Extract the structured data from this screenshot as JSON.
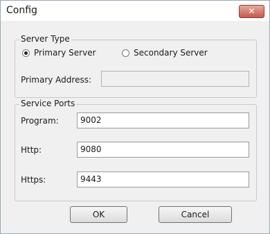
{
  "window": {
    "title": "Config",
    "close_glyph": "✕"
  },
  "server_type": {
    "label": "Server Type",
    "options": [
      {
        "label": "Primary Server",
        "checked": true
      },
      {
        "label": "Secondary Server",
        "checked": false
      }
    ],
    "primary_address": {
      "label": "Primary Address:",
      "value": ""
    }
  },
  "service_ports": {
    "label": "Service Ports",
    "program": {
      "label": "Program:",
      "value": "9002"
    },
    "http": {
      "label": "Http:",
      "value": "9080"
    },
    "https": {
      "label": "Https:",
      "value": "9443"
    }
  },
  "buttons": {
    "ok": "OK",
    "cancel": "Cancel"
  }
}
